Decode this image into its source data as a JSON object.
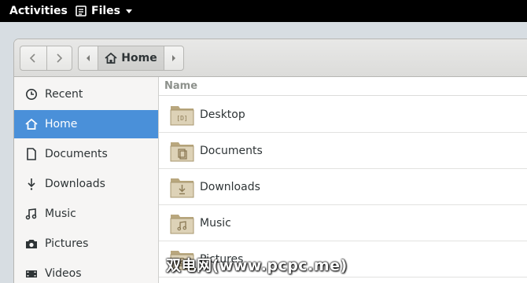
{
  "topbar": {
    "activities": "Activities",
    "app_name": "Files"
  },
  "window": {
    "path": {
      "current": "Home"
    }
  },
  "sidebar": {
    "items": [
      {
        "label": "Recent",
        "icon": "clock-icon",
        "active": false
      },
      {
        "label": "Home",
        "icon": "home-icon",
        "active": true
      },
      {
        "label": "Documents",
        "icon": "document-icon",
        "active": false
      },
      {
        "label": "Downloads",
        "icon": "download-icon",
        "active": false
      },
      {
        "label": "Music",
        "icon": "music-icon",
        "active": false
      },
      {
        "label": "Pictures",
        "icon": "camera-icon",
        "active": false
      },
      {
        "label": "Videos",
        "icon": "video-icon",
        "active": false
      }
    ]
  },
  "list": {
    "column_name": "Name",
    "rows": [
      {
        "name": "Desktop",
        "icon": "desktop-folder-icon"
      },
      {
        "name": "Documents",
        "icon": "documents-folder-icon"
      },
      {
        "name": "Downloads",
        "icon": "downloads-folder-icon"
      },
      {
        "name": "Music",
        "icon": "music-folder-icon"
      },
      {
        "name": "Pictures",
        "icon": "pictures-folder-icon"
      }
    ]
  },
  "watermark": "双电网(www.pcpc.me)",
  "colors": {
    "accent": "#4a90d9",
    "topbar": "#000000",
    "folder": "#c8b891"
  }
}
